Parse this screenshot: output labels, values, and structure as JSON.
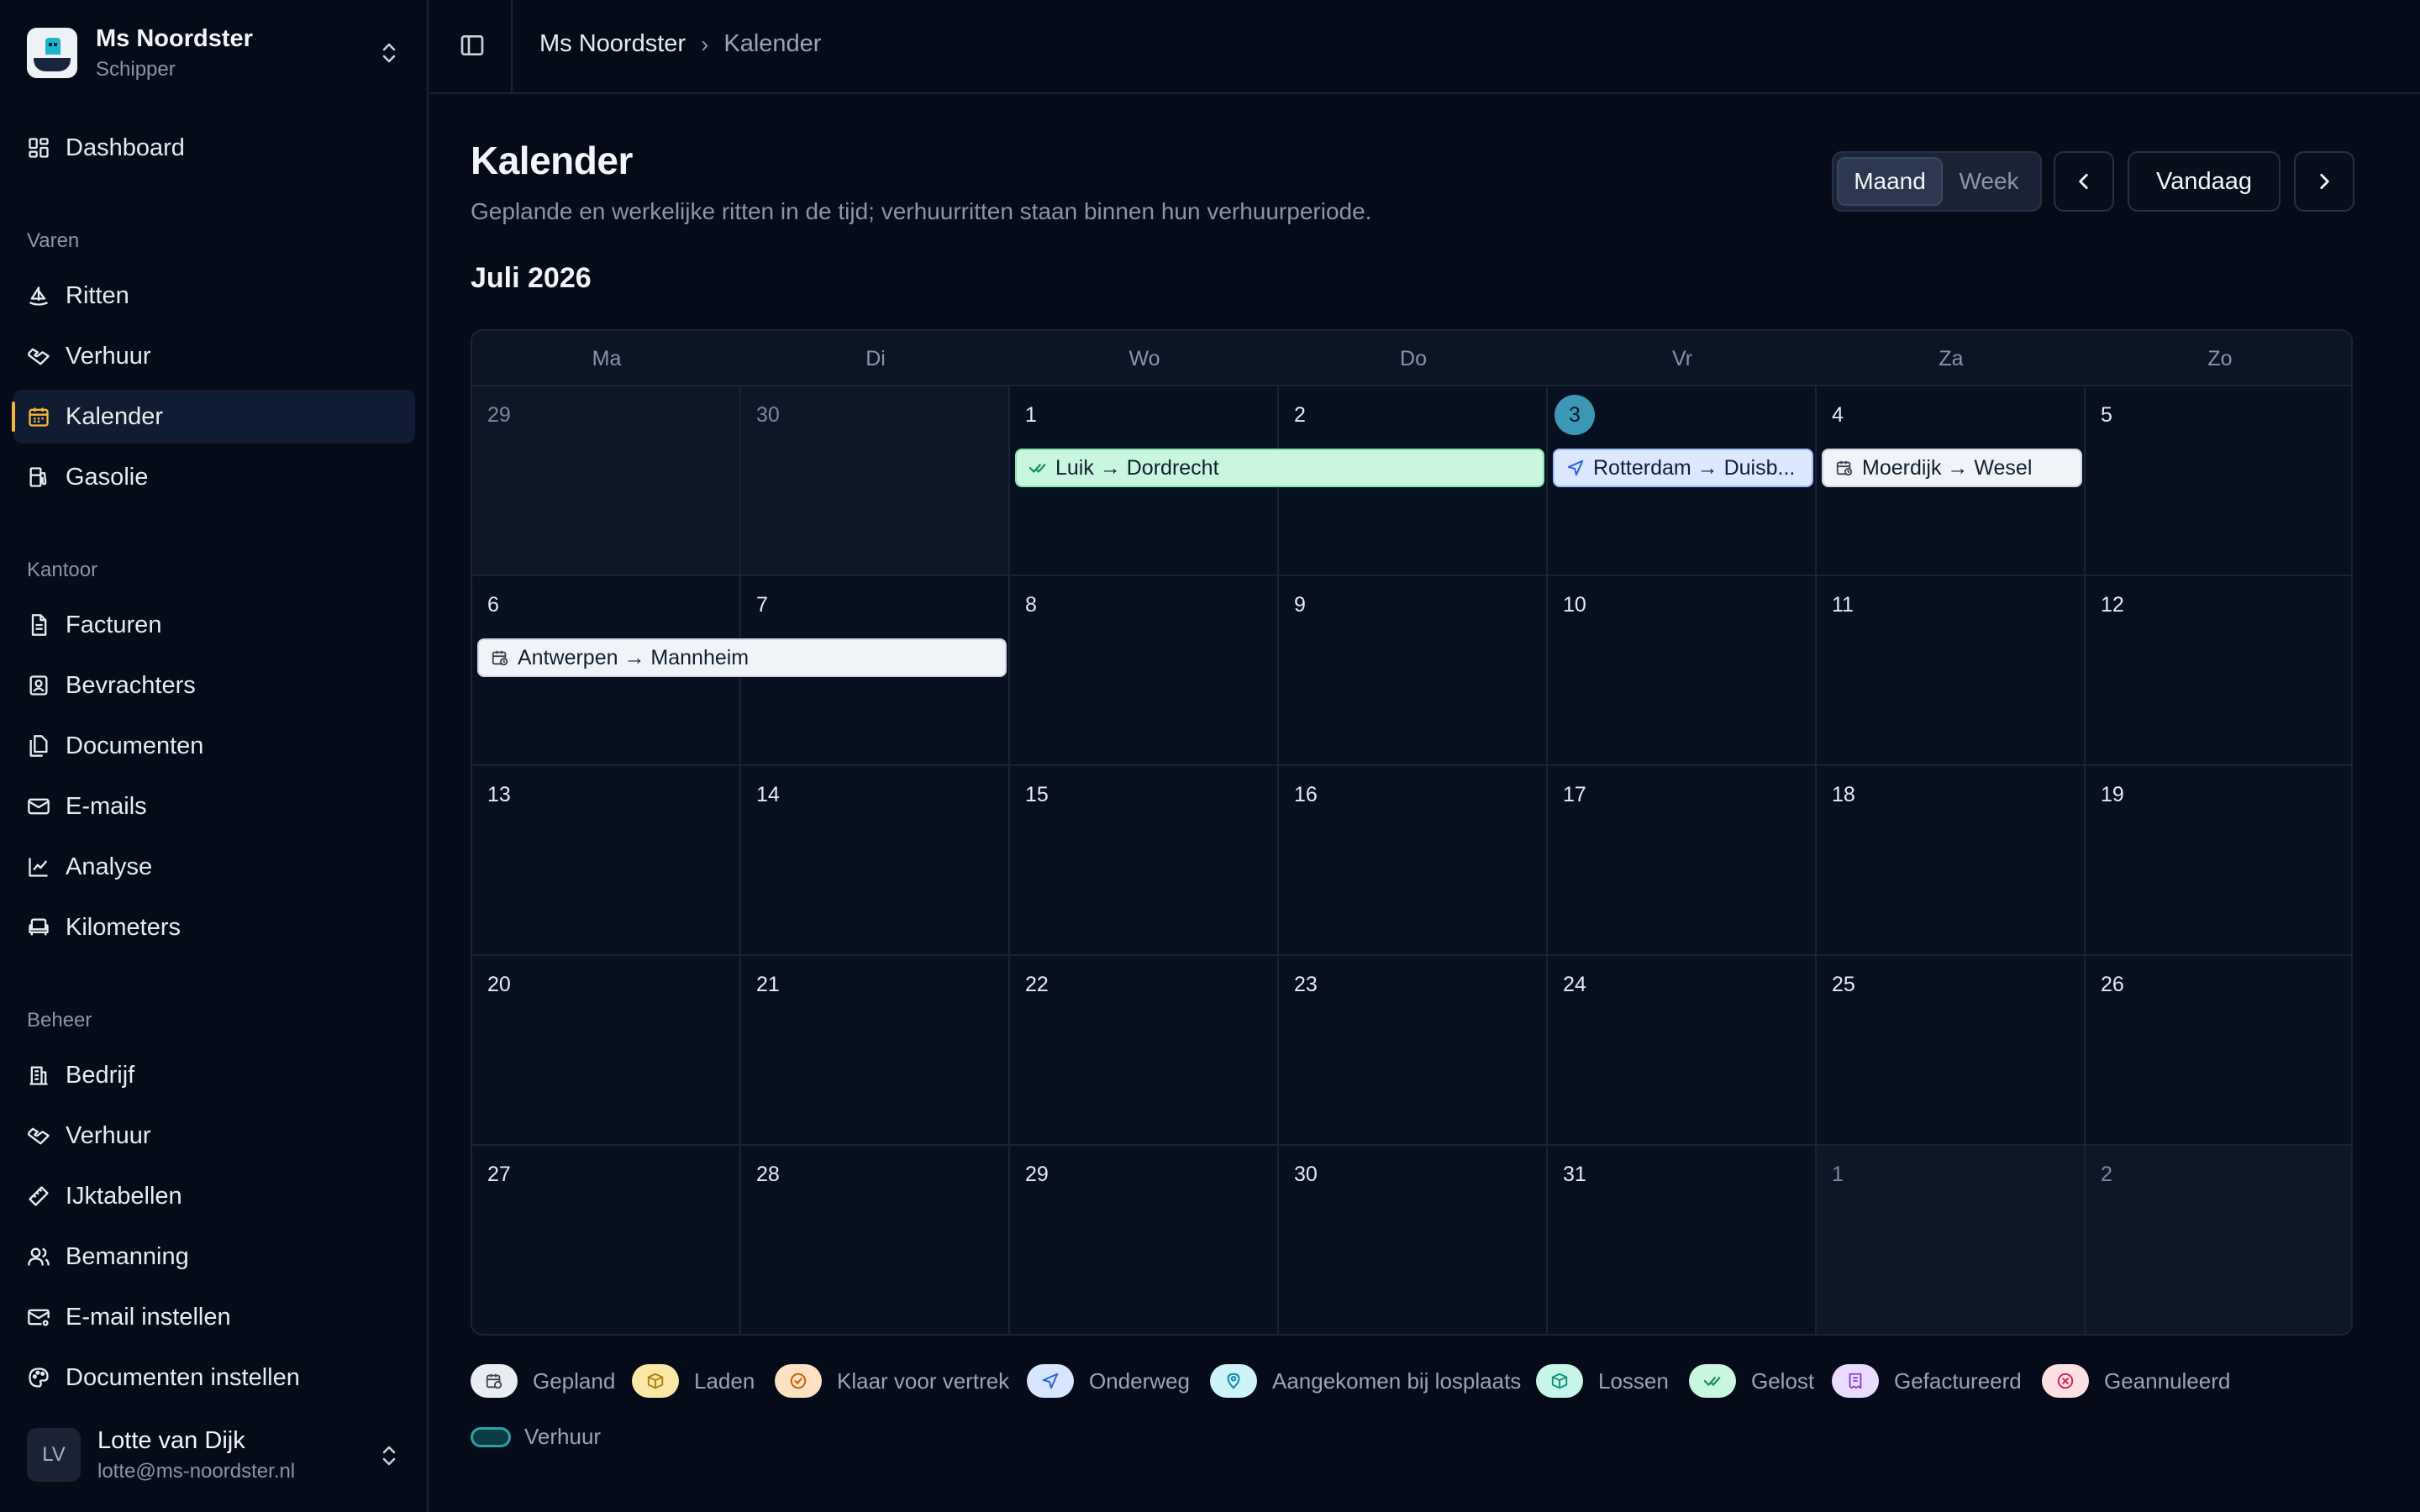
{
  "sidebar": {
    "ship_name": "Ms Noordster",
    "ship_role": "Schipper",
    "items": [
      {
        "label": "Dashboard"
      },
      {
        "label": "Ritten"
      },
      {
        "label": "Verhuur"
      },
      {
        "label": "Kalender"
      },
      {
        "label": "Gasolie"
      },
      {
        "label": "Facturen"
      },
      {
        "label": "Bevrachters"
      },
      {
        "label": "Documenten"
      },
      {
        "label": "E-mails"
      },
      {
        "label": "Analyse"
      },
      {
        "label": "Kilometers"
      },
      {
        "label": "Bedrijf"
      },
      {
        "label": "Verhuur"
      },
      {
        "label": "IJktabellen"
      },
      {
        "label": "Bemanning"
      },
      {
        "label": "E-mail instellen"
      },
      {
        "label": "Documenten instellen"
      }
    ],
    "sections": {
      "varen": "Varen",
      "kantoor": "Kantoor",
      "beheer": "Beheer"
    },
    "user": {
      "initials": "LV",
      "name": "Lotte van Dijk",
      "email": "lotte@ms-noordster.nl"
    }
  },
  "topbar": {
    "crumb_ship": "Ms Noordster",
    "crumb_page": "Kalender"
  },
  "header": {
    "title": "Kalender",
    "subtitle": "Geplande en werkelijke ritten in de tijd; verhuurritten staan binnen hun verhuurperiode.",
    "month": "Juli 2026",
    "view_month": "Maand",
    "view_week": "Week",
    "today": "Vandaag"
  },
  "calendar": {
    "weekdays": [
      "Ma",
      "Di",
      "Wo",
      "Do",
      "Vr",
      "Za",
      "Zo"
    ],
    "weeks": [
      [
        "29",
        "30",
        "1",
        "2",
        "3",
        "4",
        "5"
      ],
      [
        "6",
        "7",
        "8",
        "9",
        "10",
        "11",
        "12"
      ],
      [
        "13",
        "14",
        "15",
        "16",
        "17",
        "18",
        "19"
      ],
      [
        "20",
        "21",
        "22",
        "23",
        "24",
        "25",
        "26"
      ],
      [
        "27",
        "28",
        "29",
        "30",
        "31",
        "1",
        "2"
      ]
    ],
    "today": "3",
    "events": [
      {
        "label": "Luik → Dordrecht",
        "status": "Gelost"
      },
      {
        "label": "Rotterdam → Duisb...",
        "status": "Onderweg"
      },
      {
        "label": "Moerdijk → Wesel",
        "status": "Gepland"
      },
      {
        "label": "Antwerpen → Mannheim",
        "status": "Gepland"
      }
    ]
  },
  "legend": [
    {
      "label": "Gepland",
      "color": "#e9edf3"
    },
    {
      "label": "Laden",
      "color": "#fbe7a6"
    },
    {
      "label": "Klaar voor vertrek",
      "color": "#fde1c2"
    },
    {
      "label": "Onderweg",
      "color": "#d7e5ff"
    },
    {
      "label": "Aangekomen bij losplaats",
      "color": "#cdf3fb"
    },
    {
      "label": "Lossen",
      "color": "#c7f5ea"
    },
    {
      "label": "Gelost",
      "color": "#c9f6de"
    },
    {
      "label": "Gefactureerd",
      "color": "#eadcff"
    },
    {
      "label": "Geannuleerd",
      "color": "#fde0e6"
    },
    {
      "label": "Verhuur",
      "color": "#2aa3a7"
    }
  ]
}
